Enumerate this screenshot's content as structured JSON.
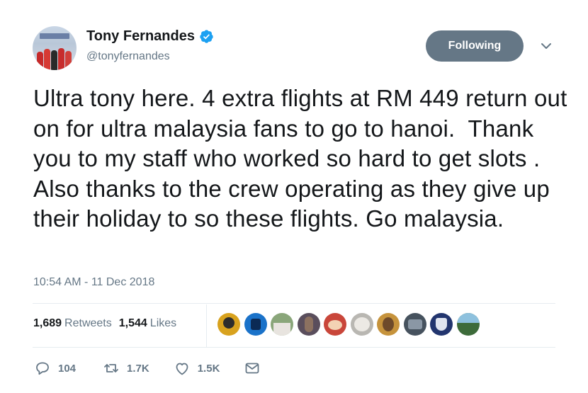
{
  "user": {
    "display_name": "Tony Fernandes",
    "handle": "@tonyfernandes",
    "verified": true,
    "avatar_icon": "profile-photo",
    "follow_button_label": "Following"
  },
  "tweet": {
    "text": "Ultra tony here. 4 extra flights at RM 449 return out on for ultra malaysia fans to go to hanoi.  Thank you to my staff who worked so hard to get slots . Also thanks to the crew operating as they give up their holiday to so these flights. Go malaysia.",
    "timestamp": "10:54 AM - 11 Dec 2018"
  },
  "stats": {
    "retweets_count": "1,689",
    "retweets_label": "Retweets",
    "likes_count": "1,544",
    "likes_label": "Likes"
  },
  "likers": [
    {
      "icon": "liker-avatar-1",
      "color": "#d8a21e"
    },
    {
      "icon": "liker-avatar-2",
      "color": "#1a72c9"
    },
    {
      "icon": "liker-avatar-3",
      "color": "#8aa67a"
    },
    {
      "icon": "liker-avatar-4",
      "color": "#5a4e5c"
    },
    {
      "icon": "liker-avatar-5",
      "color": "#c9463a"
    },
    {
      "icon": "liker-avatar-6",
      "color": "#b9b7b2"
    },
    {
      "icon": "liker-avatar-7",
      "color": "#c6933c"
    },
    {
      "icon": "liker-avatar-8",
      "color": "#46525e"
    },
    {
      "icon": "liker-avatar-9",
      "color": "#22356e"
    },
    {
      "icon": "liker-avatar-10",
      "color": "#3d6b3a"
    }
  ],
  "actions": {
    "reply_count": "104",
    "retweet_count": "1.7K",
    "like_count": "1.5K"
  },
  "colors": {
    "verified_blue": "#1da1f2",
    "secondary_text": "#657786",
    "primary_text": "#14171a",
    "following_button_bg": "#657786"
  }
}
